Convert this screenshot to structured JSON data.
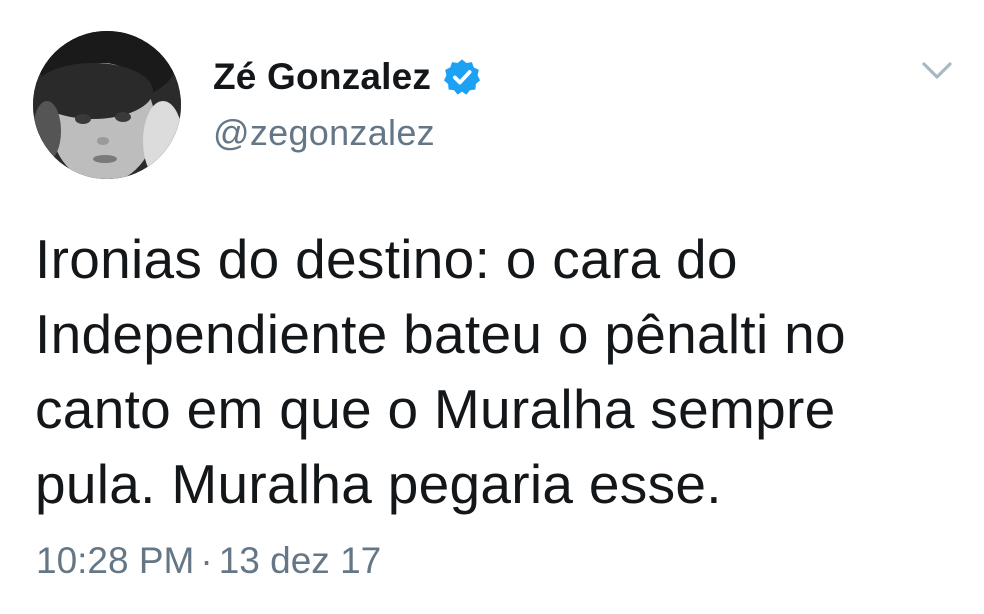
{
  "author": {
    "display_name": "Zé Gonzalez",
    "handle": "@zegonzalez",
    "verified": true,
    "avatar_icon": "user-avatar-photo"
  },
  "tweet": {
    "lines": [
      "Ironias do destino: o cara do",
      "Independiente bateu o pênalti no",
      "canto em que o Muralha sempre",
      "pula. Muralha pegaria esse."
    ]
  },
  "meta": {
    "time": "10:28 PM",
    "separator": "·",
    "date": "13 dez 17"
  },
  "icons": {
    "verified": "verified-badge-icon",
    "menu": "chevron-down-icon"
  },
  "colors": {
    "text": "#14171a",
    "secondary": "#657786",
    "verified_blue": "#1da1f2",
    "caret": "#aab8c2"
  }
}
